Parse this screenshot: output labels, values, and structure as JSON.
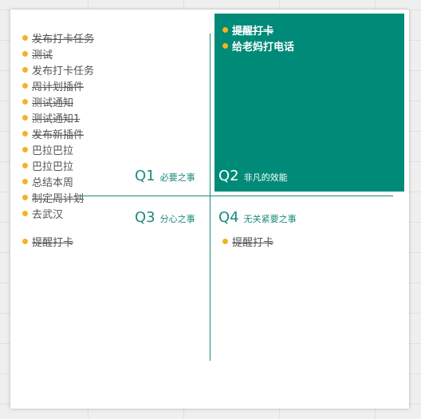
{
  "quadrants": {
    "q1": {
      "number": "Q1",
      "title": "必要之事",
      "items": [
        {
          "text": "发布打卡任务",
          "done": true
        },
        {
          "text": "测试",
          "done": true
        },
        {
          "text": "发布打卡任务",
          "done": false
        },
        {
          "text": "周计划插件",
          "done": true
        },
        {
          "text": "测试通知",
          "done": true
        },
        {
          "text": "测试通知1",
          "done": true
        },
        {
          "text": "发布新插件",
          "done": true
        },
        {
          "text": "巴拉巴拉",
          "done": false
        },
        {
          "text": "巴拉巴拉",
          "done": false
        },
        {
          "text": "总结本周",
          "done": false
        },
        {
          "text": "制定周计划",
          "done": true
        },
        {
          "text": "去武汉",
          "done": false
        }
      ]
    },
    "q2": {
      "number": "Q2",
      "title": "非凡的效能",
      "items": [
        {
          "text": "提醒打卡",
          "done": true
        },
        {
          "text": "给老妈打电话",
          "done": false
        }
      ]
    },
    "q3": {
      "number": "Q3",
      "title": "分心之事",
      "items": [
        {
          "text": "提醒打卡",
          "done": true
        }
      ]
    },
    "q4": {
      "number": "Q4",
      "title": "无关紧要之事",
      "items": [
        {
          "text": "提醒打卡",
          "done": true
        }
      ]
    }
  },
  "colors": {
    "accent": "#008a78",
    "line": "#1c8a7c",
    "bullet": "#f5b31e",
    "text": "#555555",
    "background": "#ffffff"
  }
}
